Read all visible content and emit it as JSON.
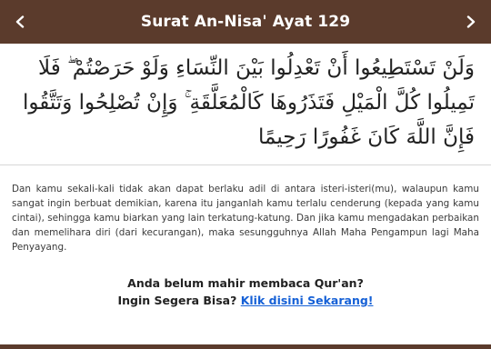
{
  "header": {
    "title": "Surat An-Nisa' Ayat 129",
    "prev_icon": "chevron-left-icon",
    "next_icon": "chevron-right-icon",
    "background_color": "#5b3b2c"
  },
  "ayat": {
    "arabic": "وَلَنْ تَسْتَطِيعُوا أَنْ تَعْدِلُوا بَيْنَ النِّسَاءِ وَلَوْ حَرَصْتُمْ ۖ فَلَا تَمِيلُوا كُلَّ الْمَيْلِ فَتَذَرُوهَا كَالْمُعَلَّقَةِ ۚ وَإِنْ تُصْلِحُوا وَتَتَّقُوا فَإِنَّ اللَّهَ كَانَ غَفُورًا رَحِيمًا"
  },
  "translation": "Dan kamu sekali-kali tidak akan dapat berlaku adil di antara isteri-isteri(mu), walaupun kamu sangat ingin berbuat demikian, karena itu janganlah kamu terlalu cenderung (kepada yang kamu cintai), sehingga kamu biarkan yang lain terkatung-katung. Dan jika kamu mengadakan perbaikan dan memelihara diri (dari kecurangan), maka sesungguhnya Allah Maha Pengampun lagi Maha Penyayang.",
  "cta": {
    "line1": "Anda belum mahir membaca Qur'an?",
    "line2": "Ingin Segera Bisa?",
    "link_text": "Klik disini Sekarang!",
    "link_color": "#1560d6"
  }
}
